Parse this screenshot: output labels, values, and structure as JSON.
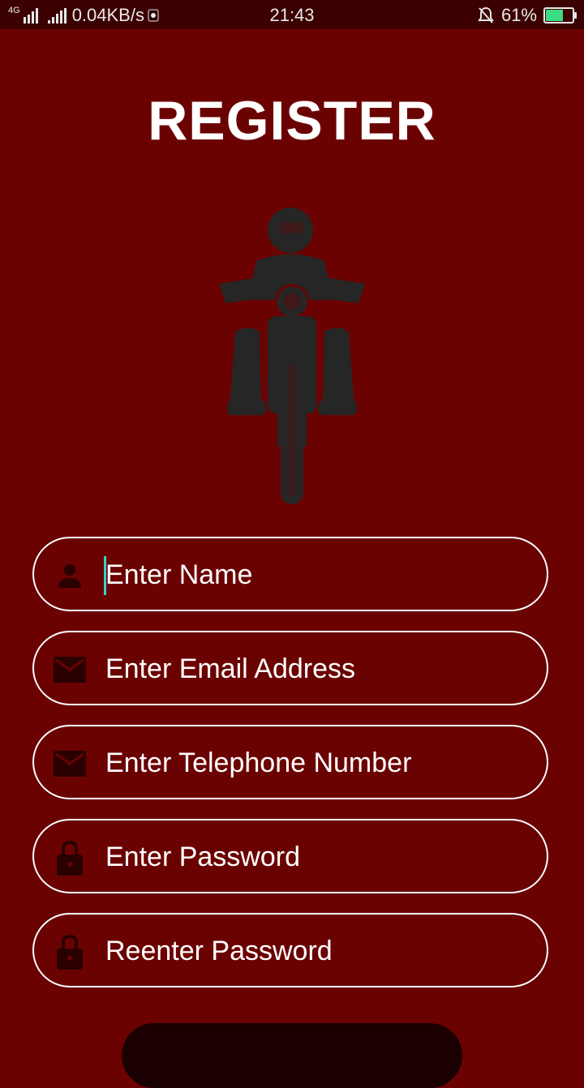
{
  "status_bar": {
    "network": "4G",
    "speed": "0.04KB/s",
    "time": "21:43",
    "battery_percent": "61%",
    "battery_level": 0.61,
    "icons": [
      "signal-icon",
      "data-speed-icon",
      "notification-muted-icon",
      "battery-icon"
    ]
  },
  "title": "REGISTER",
  "fields": [
    {
      "placeholder": "Enter Name",
      "icon": "person-icon"
    },
    {
      "placeholder": "Enter Email Address",
      "icon": "mail-icon"
    },
    {
      "placeholder": "Enter Telephone Number",
      "icon": "mail-icon"
    },
    {
      "placeholder": "Enter Password",
      "icon": "lock-icon"
    },
    {
      "placeholder": "Reenter Password",
      "icon": "lock-icon"
    }
  ],
  "colors": {
    "background": "#6b0202",
    "status_bar": "#3b0101",
    "field_border": "#ffffff",
    "icon_dark": "#2a0000",
    "accent_caret": "#3ad1c4"
  }
}
